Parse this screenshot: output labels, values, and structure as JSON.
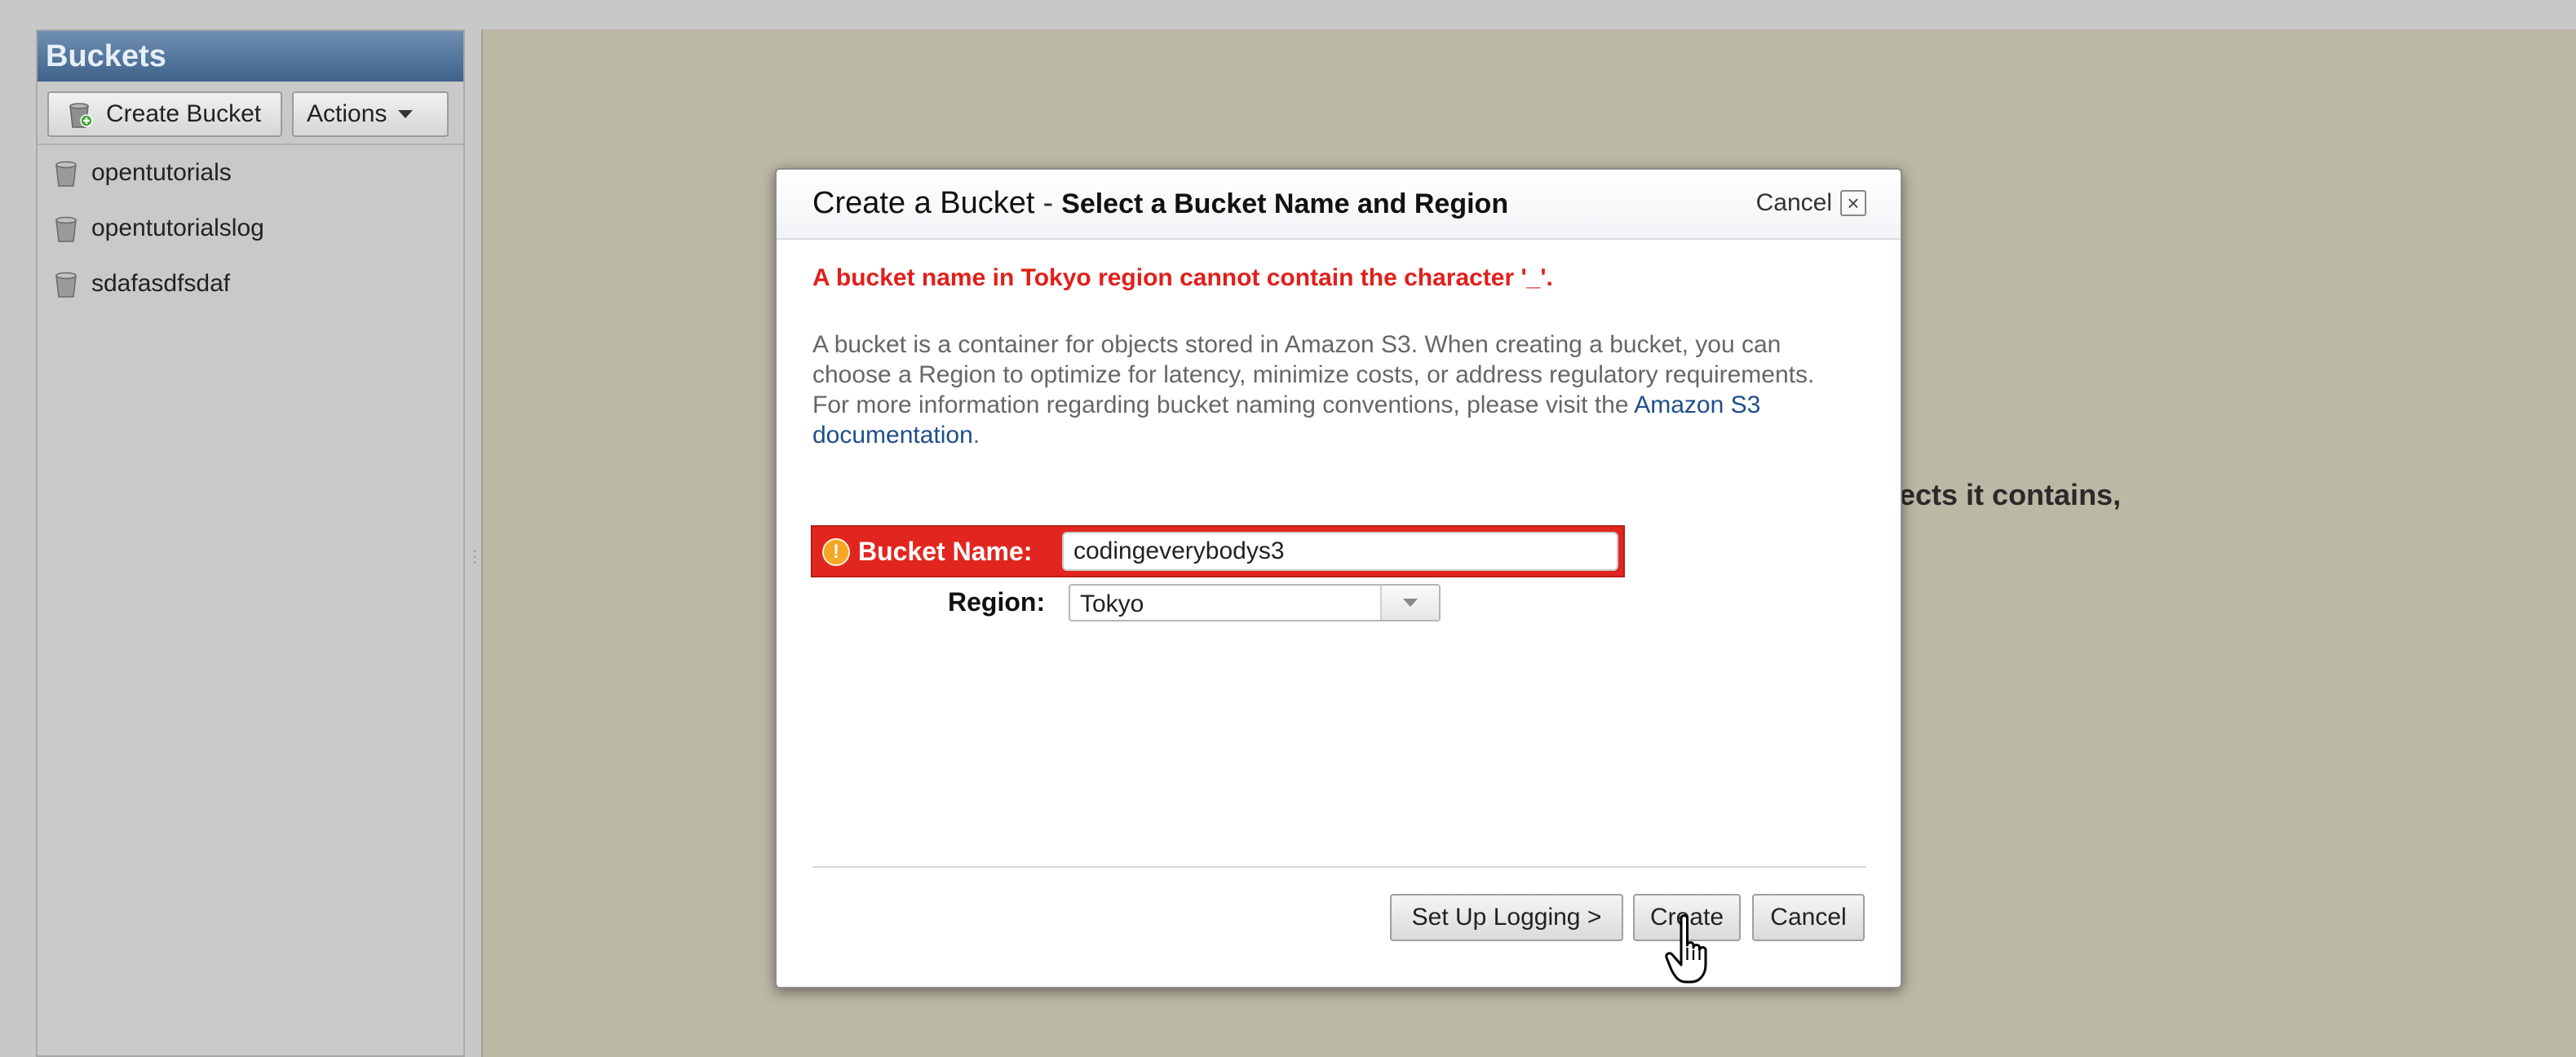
{
  "sidebar": {
    "title": "Buckets",
    "toolbar": {
      "create_bucket_label": "Create Bucket",
      "actions_label": "Actions"
    },
    "buckets": [
      {
        "name": "opentutorials"
      },
      {
        "name": "opentutorialslog"
      },
      {
        "name": "sdafasdfsdaf"
      }
    ]
  },
  "main": {
    "background_text": "jects it contains,"
  },
  "dialog": {
    "title": "Create a Bucket",
    "separator": "-",
    "subtitle": "Select a Bucket Name and Region",
    "header_cancel_label": "Cancel",
    "error_message": "A bucket name in Tokyo region cannot contain the character '_'.",
    "description": "A bucket is a container for objects stored in Amazon S3. When creating a bucket, you can choose a Region to optimize for latency, minimize costs, or address regulatory requirements. For more information regarding bucket naming conventions, please visit the",
    "doc_link_label": "Amazon S3 documentation",
    "description_end": ".",
    "bucket_name_label": "Bucket Name:",
    "bucket_name_value": "codingeverybodys3",
    "region_label": "Region:",
    "region_value": "Tokyo",
    "buttons": {
      "logging": "Set Up Logging >",
      "create": "Create",
      "cancel": "Cancel"
    }
  },
  "colors": {
    "error": "#e1261f",
    "header_blue": "#4f729b",
    "link": "#1e4e8c",
    "main_bg": "#bcb8a6"
  }
}
